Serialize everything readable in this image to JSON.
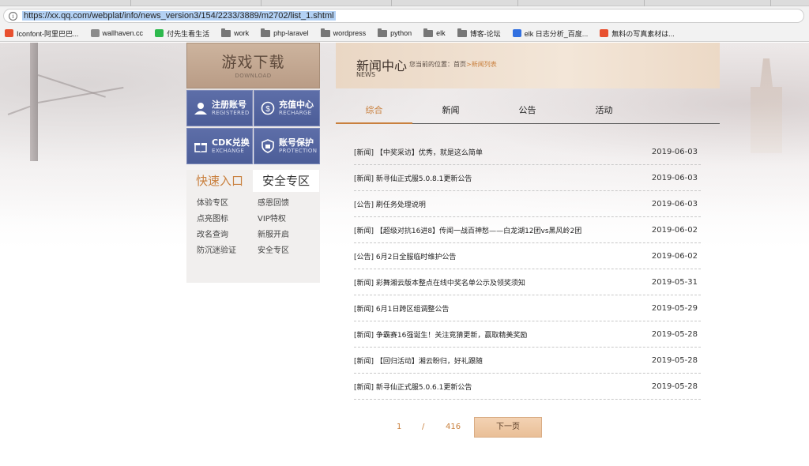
{
  "browser": {
    "url": "https://xx.qq.com/webplat/info/news_version3/154/2233/3889/m2702/list_1.shtml",
    "bookmarks": [
      {
        "label": "Iconfont-阿里巴巴...",
        "icon": "iconfont-icon",
        "color": "#e8502f"
      },
      {
        "label": "wallhaven.cc",
        "icon": "wallhaven-icon",
        "color": "#8b8b8b"
      },
      {
        "label": "付先生看生活",
        "icon": "wechat-icon",
        "color": "#2db94d"
      },
      {
        "label": "work",
        "icon": "folder-icon"
      },
      {
        "label": "php-laravel",
        "icon": "folder-icon"
      },
      {
        "label": "wordpress",
        "icon": "folder-icon"
      },
      {
        "label": "python",
        "icon": "folder-icon"
      },
      {
        "label": "elk",
        "icon": "folder-icon"
      },
      {
        "label": "博客-论坛",
        "icon": "folder-icon"
      },
      {
        "label": "elk 日志分析_百度...",
        "icon": "baidu-icon",
        "color": "#3270e0"
      },
      {
        "label": "無料の写真素材は...",
        "icon": "photo-site-icon",
        "color": "#e8502f"
      }
    ]
  },
  "sidebar": {
    "download": {
      "title": "游戏下载",
      "subtitle": "DOWNLOAD"
    },
    "tiles": [
      {
        "title": "注册账号",
        "subtitle": "REGISTERED",
        "icon": "user-icon"
      },
      {
        "title": "充值中心",
        "subtitle": "RECHARGE",
        "icon": "recharge-icon"
      },
      {
        "title": "CDK兑换",
        "subtitle": "EXCHANGE",
        "icon": "gift-icon"
      },
      {
        "title": "账号保护",
        "subtitle": "PROTECTION",
        "icon": "shield-icon"
      }
    ],
    "quick_tabs": [
      "快速入口",
      "安全专区"
    ],
    "quick_links": [
      "体验专区",
      "感恩回馈",
      "点亮图标",
      "VIP特权",
      "改名查询",
      "新服开启",
      "防沉迷验证",
      "安全专区"
    ]
  },
  "news": {
    "title": "新闻中心",
    "title_en": "NEWS",
    "crumb_prefix": "您当前的位置：",
    "crumb_home": "首页",
    "crumb_sep": ">",
    "crumb_current": "新闻列表",
    "tabs": [
      "综合",
      "新闻",
      "公告",
      "活动"
    ],
    "active_tab": "综合",
    "items": [
      {
        "title": "[新闻] 【中奖采访】优秀，就是这么简单",
        "date": "2019-06-03"
      },
      {
        "title": "[新闻] 新寻仙正式服5.0.8.1更新公告",
        "date": "2019-06-03"
      },
      {
        "title": "[公告] 刷任务处理说明",
        "date": "2019-06-03"
      },
      {
        "title": "[新闻] 【超级对抗16进8】传闻一战百神愁——白龙湖12团vs黑风岭2团",
        "date": "2019-06-02"
      },
      {
        "title": "[公告] 6月2日全服临时维护公告",
        "date": "2019-06-02"
      },
      {
        "title": "[新闻] 彩舞湘云版本整点在线中奖名单公示及领奖须知",
        "date": "2019-05-31"
      },
      {
        "title": "[新闻] 6月1日跨区组调整公告",
        "date": "2019-05-29"
      },
      {
        "title": "[新闻] 争霸赛16强诞生！关注竞猜更新，赢取精美奖励",
        "date": "2019-05-28"
      },
      {
        "title": "[新闻] 【回归活动】湘云盼归，好礼跟随",
        "date": "2019-05-28"
      },
      {
        "title": "[新闻] 新寻仙正式服5.0.6.1更新公告",
        "date": "2019-05-28"
      }
    ]
  },
  "pager": {
    "current": "1",
    "sep": "/",
    "total": "416",
    "next_label": "下一页"
  },
  "colors": {
    "accent": "#c9803e",
    "tile_blue": "#5566a0",
    "banner": "#c4a892"
  }
}
